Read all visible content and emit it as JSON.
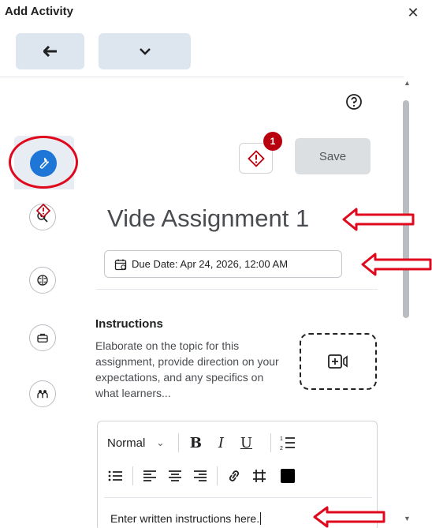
{
  "dialog": {
    "title": "Add Activity",
    "close_icon": "close-icon"
  },
  "toolbar": {
    "back_icon": "arrow-left-icon",
    "more_icon": "chevron-down-icon"
  },
  "help_icon": "help-circle-icon",
  "rail": {
    "items": [
      {
        "icon": "wrench-icon",
        "active": true
      },
      {
        "icon": "magnify-icon",
        "warning": true
      },
      {
        "icon": "brain-icon"
      },
      {
        "icon": "briefcase-icon"
      },
      {
        "icon": "people-icon"
      }
    ]
  },
  "header": {
    "warning_count": "1",
    "save_label": "Save"
  },
  "assignment": {
    "title": "Vide Assignment 1",
    "due_date": "Due Date: Apr 24, 2026, 12:00 AM"
  },
  "instructions": {
    "heading": "Instructions",
    "description": "Elaborate on the topic for this assignment, provide direction on your expectations, and any specifics on what learners..."
  },
  "editor": {
    "format": "Normal",
    "placeholder": "Enter written instructions here.",
    "color_swatch": "#000000"
  },
  "colors": {
    "accent": "#1e76d6",
    "annotation": "#e0081c",
    "badge": "#b8000e"
  }
}
